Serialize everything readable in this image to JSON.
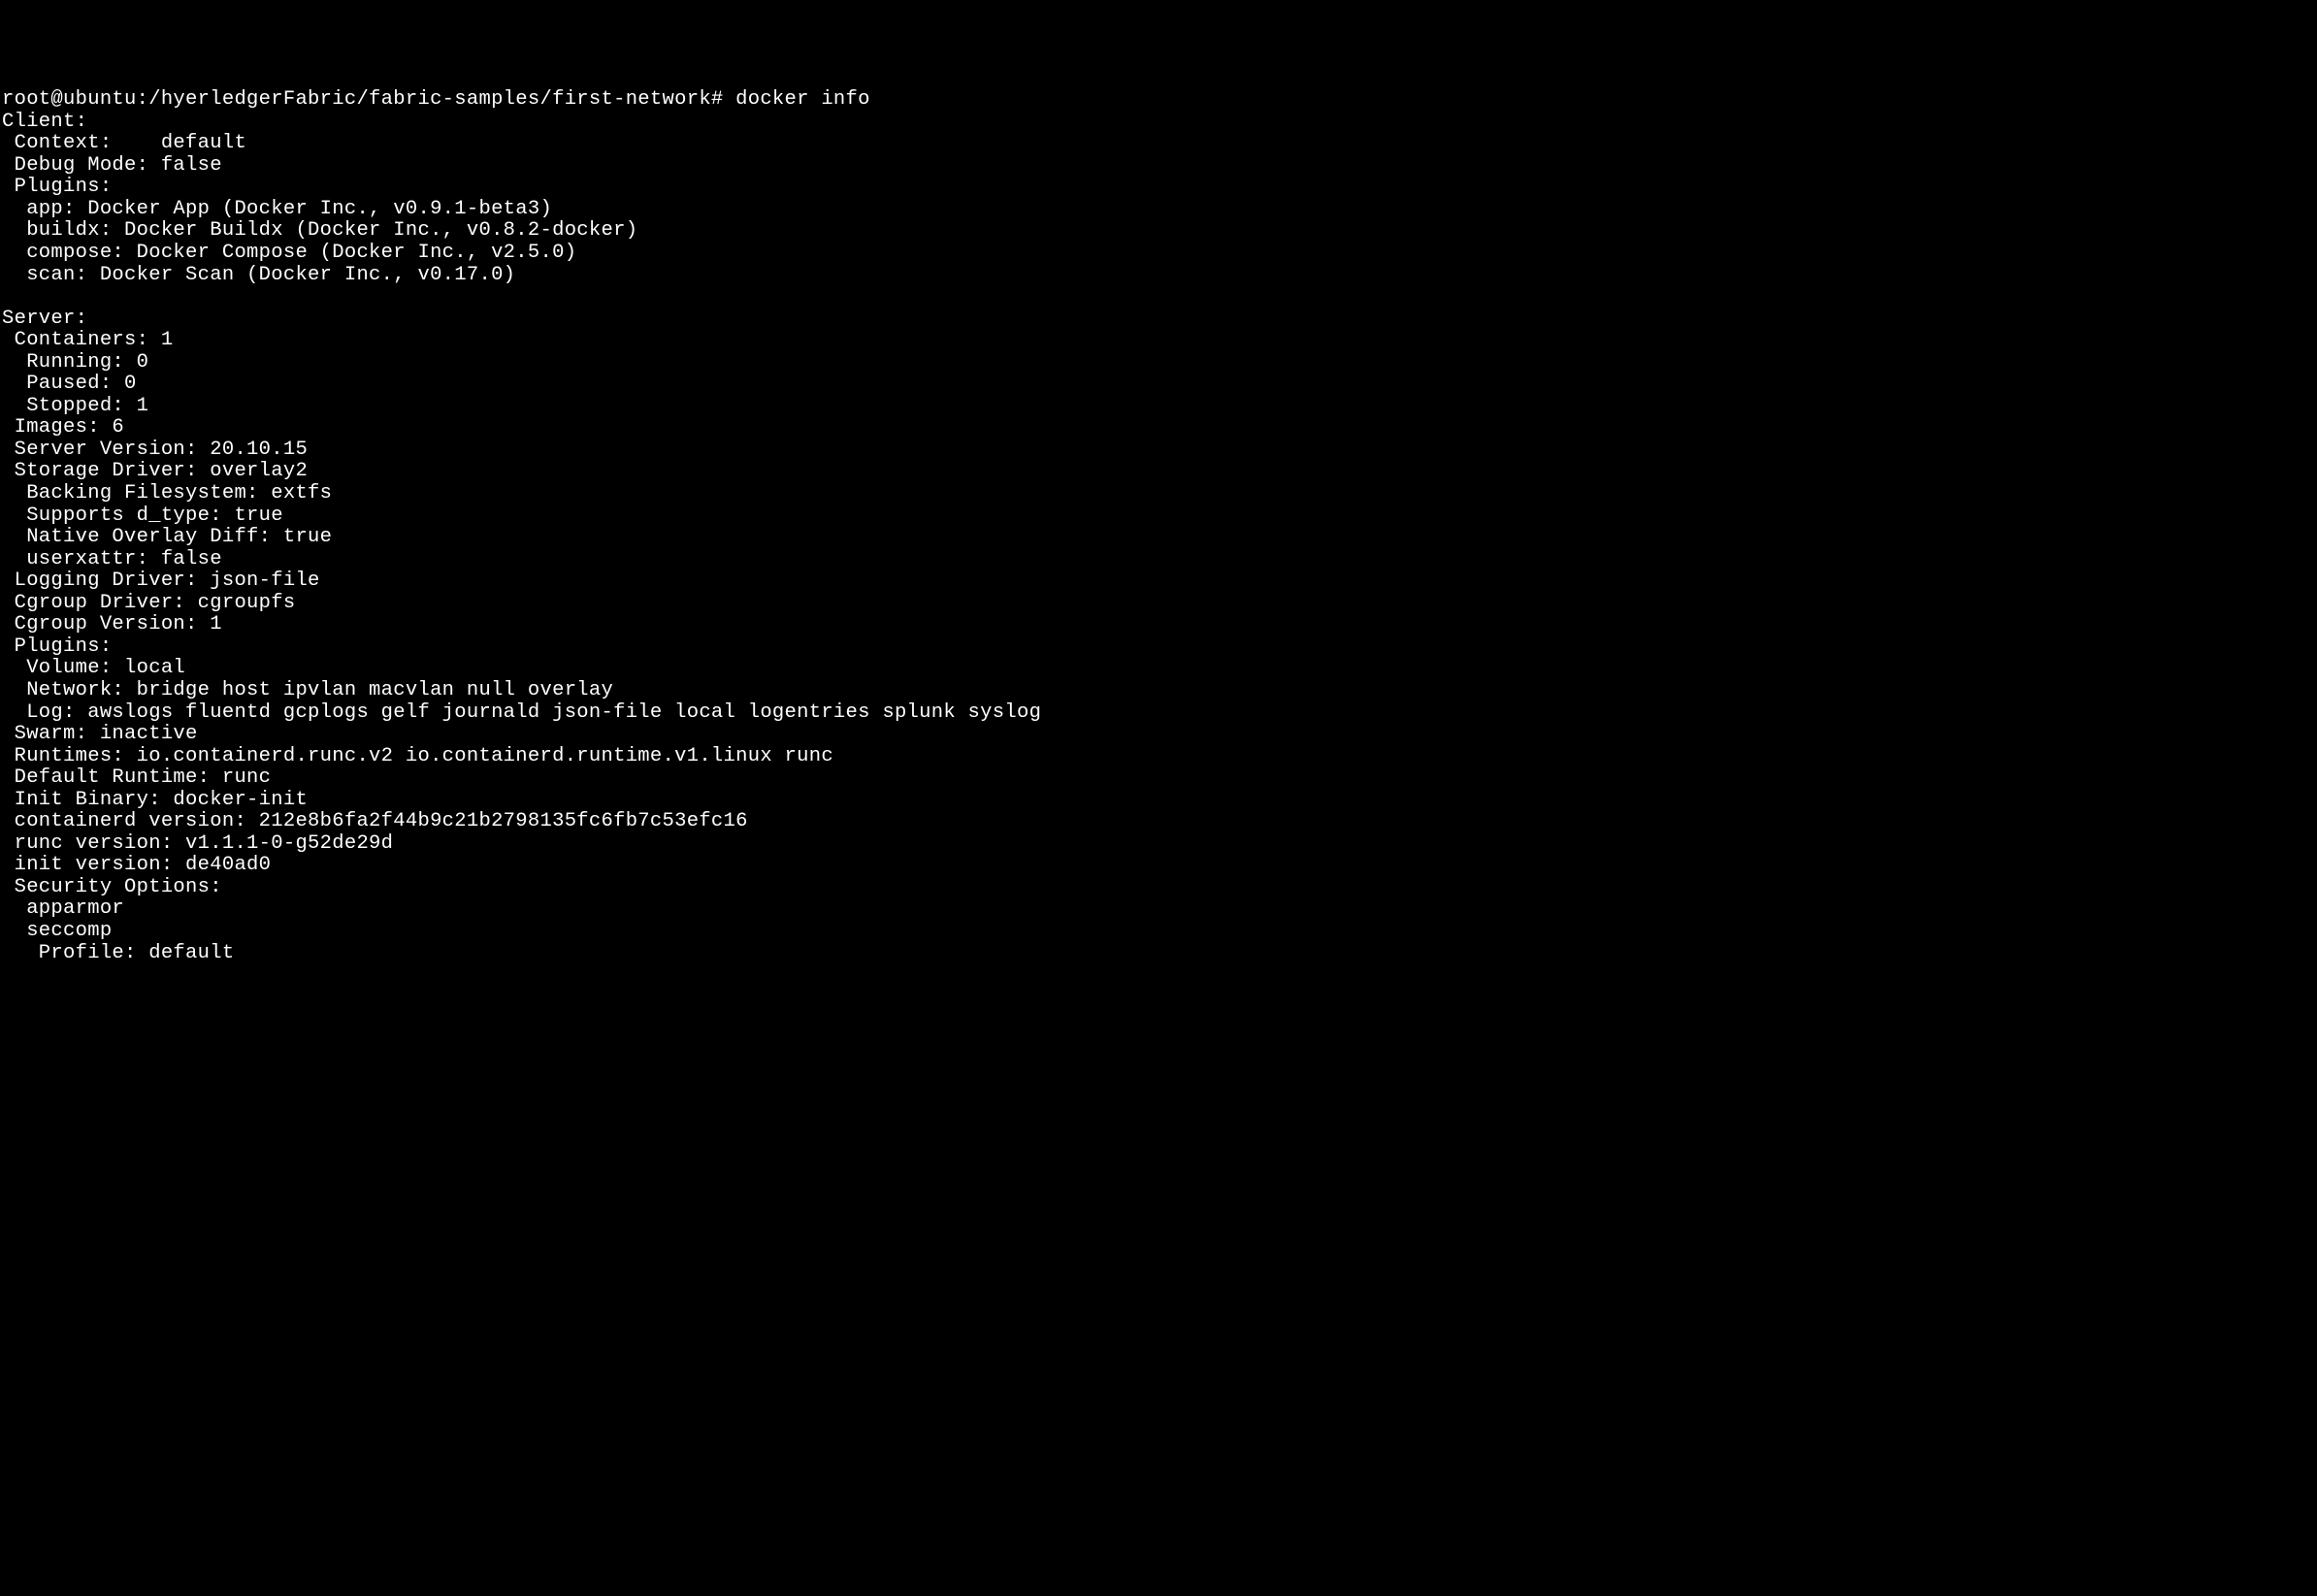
{
  "prompt": "root@ubuntu:/hyerledgerFabric/fabric-samples/first-network# docker info",
  "lines": [
    "Client:",
    " Context:    default",
    " Debug Mode: false",
    " Plugins:",
    "  app: Docker App (Docker Inc., v0.9.1-beta3)",
    "  buildx: Docker Buildx (Docker Inc., v0.8.2-docker)",
    "  compose: Docker Compose (Docker Inc., v2.5.0)",
    "  scan: Docker Scan (Docker Inc., v0.17.0)",
    "",
    "Server:",
    " Containers: 1",
    "  Running: 0",
    "  Paused: 0",
    "  Stopped: 1",
    " Images: 6",
    " Server Version: 20.10.15",
    " Storage Driver: overlay2",
    "  Backing Filesystem: extfs",
    "  Supports d_type: true",
    "  Native Overlay Diff: true",
    "  userxattr: false",
    " Logging Driver: json-file",
    " Cgroup Driver: cgroupfs",
    " Cgroup Version: 1",
    " Plugins:",
    "  Volume: local",
    "  Network: bridge host ipvlan macvlan null overlay",
    "  Log: awslogs fluentd gcplogs gelf journald json-file local logentries splunk syslog",
    " Swarm: inactive",
    " Runtimes: io.containerd.runc.v2 io.containerd.runtime.v1.linux runc",
    " Default Runtime: runc",
    " Init Binary: docker-init",
    " containerd version: 212e8b6fa2f44b9c21b2798135fc6fb7c53efc16",
    " runc version: v1.1.1-0-g52de29d",
    " init version: de40ad0",
    " Security Options:",
    "  apparmor",
    "  seccomp",
    "   Profile: default"
  ]
}
